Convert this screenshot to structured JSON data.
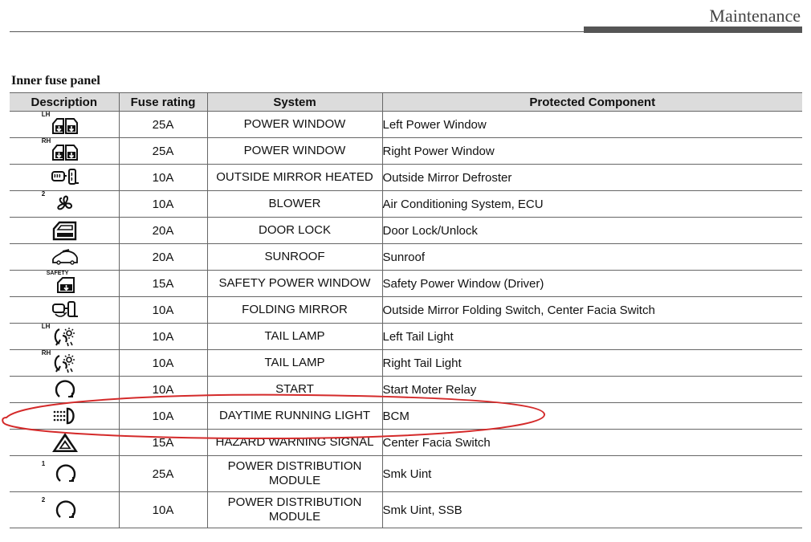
{
  "header": {
    "title": "Maintenance"
  },
  "section": {
    "title": "Inner fuse panel"
  },
  "table": {
    "headers": [
      "Description",
      "Fuse rating",
      "System",
      "Protected Component"
    ],
    "rows": [
      {
        "icon": "power-window-icon",
        "superscript": "LH",
        "rating": "25A",
        "system": "POWER WINDOW",
        "component": "Left Power Window"
      },
      {
        "icon": "power-window-icon",
        "superscript": "RH",
        "rating": "25A",
        "system": "POWER WINDOW",
        "component": "Right Power Window"
      },
      {
        "icon": "mirror-heater-icon",
        "superscript": "",
        "rating": "10A",
        "system": "OUTSIDE MIRROR HEATED",
        "component": "Outside Mirror Defroster"
      },
      {
        "icon": "blower-fan-icon",
        "superscript": "2",
        "rating": "10A",
        "system": "BLOWER",
        "component": "Air Conditioning System, ECU"
      },
      {
        "icon": "door-lock-icon",
        "superscript": "",
        "rating": "20A",
        "system": "DOOR LOCK",
        "component": "Door Lock/Unlock"
      },
      {
        "icon": "sunroof-icon",
        "superscript": "",
        "rating": "20A",
        "system": "SUNROOF",
        "component": "Sunroof"
      },
      {
        "icon": "safety-window-icon",
        "superscript": "SAFETY",
        "rating": "15A",
        "system": "SAFETY POWER WINDOW",
        "component": "Safety Power Window (Driver)"
      },
      {
        "icon": "folding-mirror-icon",
        "superscript": "",
        "rating": "10A",
        "system": "FOLDING MIRROR",
        "component": "Outside Mirror Folding Switch, Center Facia Switch"
      },
      {
        "icon": "tail-lamp-icon",
        "superscript": "LH",
        "rating": "10A",
        "system": "TAIL LAMP",
        "component": "Left Tail Light"
      },
      {
        "icon": "tail-lamp-icon",
        "superscript": "RH",
        "rating": "10A",
        "system": "TAIL LAMP",
        "component": "Right Tail Light"
      },
      {
        "icon": "start-icon",
        "superscript": "",
        "rating": "10A",
        "system": "START",
        "component": "Start Moter Relay"
      },
      {
        "icon": "daytime-light-icon",
        "superscript": "",
        "rating": "10A",
        "system": "DAYTIME RUNNING LIGHT",
        "component": "BCM"
      },
      {
        "icon": "hazard-icon",
        "superscript": "",
        "rating": "15A",
        "system": "HAZARD WARNING SIGNAL",
        "component": "Center Facia Switch"
      },
      {
        "icon": "power-distribution-icon",
        "superscript": "1",
        "rating": "25A",
        "system": "POWER DISTRIBUTION MODULE",
        "component": "Smk Uint"
      },
      {
        "icon": "power-distribution-icon",
        "superscript": "2",
        "rating": "10A",
        "system": "POWER DISTRIBUTION MODULE",
        "component": "Smk Uint, SSB"
      }
    ]
  },
  "annotation": {
    "color": "#d42a2a",
    "highlighted_row": 11
  },
  "colors": {
    "header_bg": "#dcdcdc",
    "rule": "#555555"
  }
}
